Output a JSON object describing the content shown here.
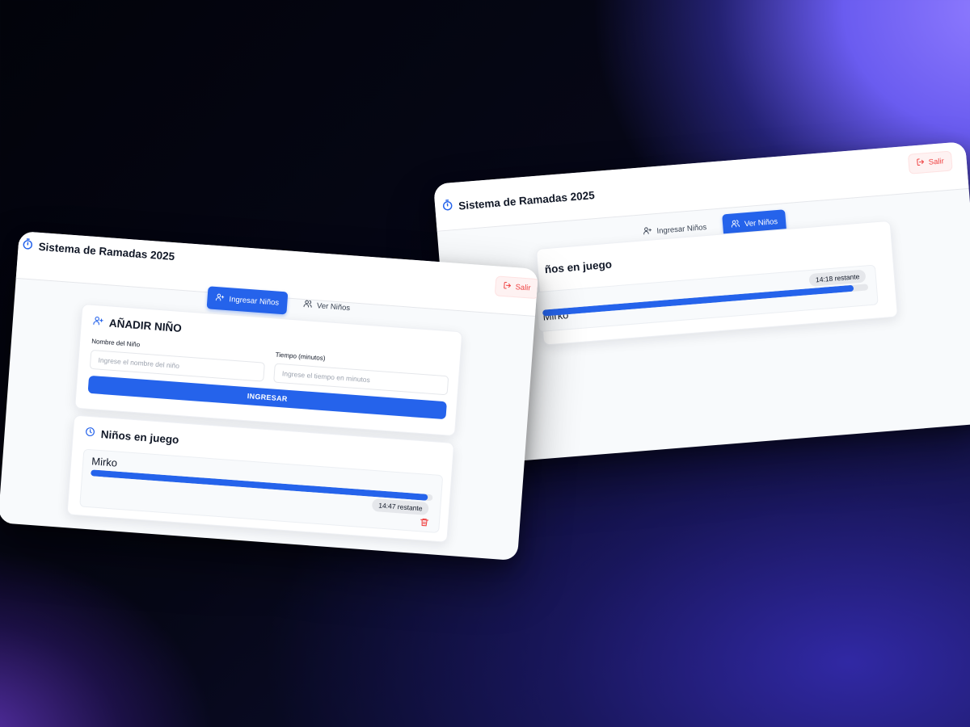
{
  "app": {
    "title": "Sistema de Ramadas 2025",
    "logout_label": "Salir"
  },
  "tabs": [
    {
      "label": "Ingresar Niños",
      "icon": "user-plus-icon"
    },
    {
      "label": "Ver Niños",
      "icon": "users-icon"
    }
  ],
  "add_form": {
    "title": "AÑADIR NIÑO",
    "name_label": "Nombre del Niño",
    "name_placeholder": "Ingrese el nombre del niño",
    "time_label": "Tiempo (minutos)",
    "time_placeholder": "Ingrese el tiempo en minutos",
    "submit_label": "INGRESAR"
  },
  "active_list": {
    "title": "Niños en juego",
    "title_partial": "ños en juego"
  },
  "screens": [
    {
      "active_tab": "Ingresar Niños",
      "players": [
        {
          "name": "Mirko",
          "remaining": "14:47 restante",
          "progress": 0.985
        }
      ]
    },
    {
      "active_tab": "Ver Niños",
      "players": [
        {
          "name": "Mirko",
          "remaining": "14:18 restante",
          "progress": 0.955
        }
      ]
    }
  ],
  "colors": {
    "accent": "#2563eb",
    "danger": "#ef4444",
    "background": "#f8fafc"
  }
}
